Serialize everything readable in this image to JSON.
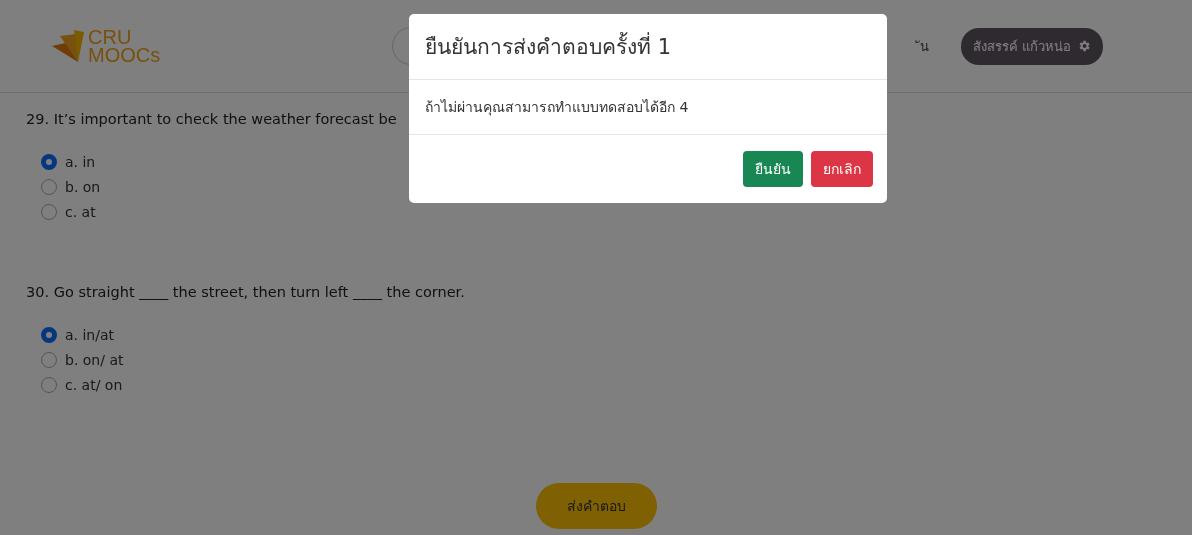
{
  "header": {
    "logo": {
      "line_1": "CRU",
      "line_2": "MOOCs"
    },
    "nav_text": "ัน",
    "user_button": "สังสรรค์ แก้วหน่อ"
  },
  "questions": [
    {
      "text": "29. It’s important to check the weather forecast be",
      "options": [
        {
          "label": "a. in",
          "selected": true
        },
        {
          "label": "b. on",
          "selected": false
        },
        {
          "label": "c. at",
          "selected": false
        }
      ]
    },
    {
      "text": "30. Go straight ____ the street, then turn left ____ the corner.",
      "options": [
        {
          "label": "a. in/at",
          "selected": true
        },
        {
          "label": "b. on/ at",
          "selected": false
        },
        {
          "label": "c. at/ on",
          "selected": false
        }
      ]
    }
  ],
  "submit_button": "ส่งคำตอบ",
  "modal": {
    "title": "ยืนยันการส่งคำตอบครั้งที่ 1",
    "message": "ถ้าไม่ผ่านคุณสามารถทำแบบทดสอบได้อีก 4",
    "buttons": [
      {
        "label": "ยืนยัน",
        "kind": "confirm"
      },
      {
        "label": "ยกเลิก",
        "kind": "cancel"
      }
    ]
  }
}
